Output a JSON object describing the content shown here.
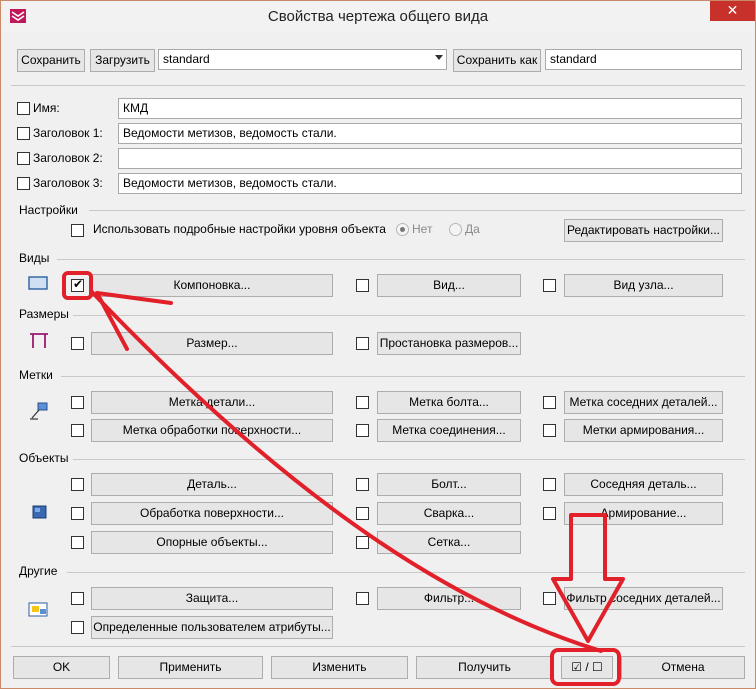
{
  "window": {
    "title": "Свойства чертежа общего вида"
  },
  "toolbar": {
    "save_label": "Сохранить",
    "load_label": "Загрузить",
    "preset_value": "standard",
    "save_as_label": "Сохранить как",
    "save_as_value": "standard"
  },
  "fields": {
    "name_label": "Имя:",
    "name_value": "КМД",
    "title1_label": "Заголовок 1:",
    "title1_value": "Ведомости метизов,  ведомость стали.",
    "title2_label": "Заголовок 2:",
    "title2_value": "",
    "title3_label": "Заголовок 3:",
    "title3_value": "Ведомости метизов,  ведомость стали."
  },
  "settings": {
    "section": "Настройки",
    "detailed_label": "Использовать подробные настройки уровня объекта",
    "radio_no": "Нет",
    "radio_yes": "Да",
    "edit_button": "Редактировать настройки..."
  },
  "views": {
    "section": "Виды",
    "layout": "Компоновка...",
    "view": "Вид...",
    "node_view": "Вид узла..."
  },
  "dimensions": {
    "section": "Размеры",
    "dimension": "Размер...",
    "placement": "Простановка размеров..."
  },
  "marks": {
    "section": "Метки",
    "part_mark": "Метка детали...",
    "bolt_mark": "Метка болта...",
    "neighbor_mark": "Метка соседних деталей...",
    "surface_mark": "Метка обработки поверхности...",
    "connection_mark": "Метка соединения...",
    "reinforcement_marks": "Метки армирования..."
  },
  "objects": {
    "section": "Объекты",
    "part": "Деталь...",
    "bolt": "Болт...",
    "neighbor_part": "Соседняя деталь...",
    "surface_treatment": "Обработка поверхности...",
    "weld": "Сварка...",
    "reinforcement": "Армирование...",
    "reference_objects": "Опорные объекты...",
    "grid": "Сетка..."
  },
  "other": {
    "section": "Другие",
    "protection": "Защита...",
    "filter": "Фильтр...",
    "neighbor_filter": "Фильтр соседних деталей...",
    "user_attributes": "Определенные пользователем атрибуты..."
  },
  "bottom": {
    "ok": "OK",
    "apply": "Применить",
    "modify": "Изменить",
    "get": "Получить",
    "toggle": "☑ / ☐",
    "cancel": "Отмена"
  },
  "colors": {
    "annotation": "#e2202a",
    "title_close": "#c7302b"
  }
}
